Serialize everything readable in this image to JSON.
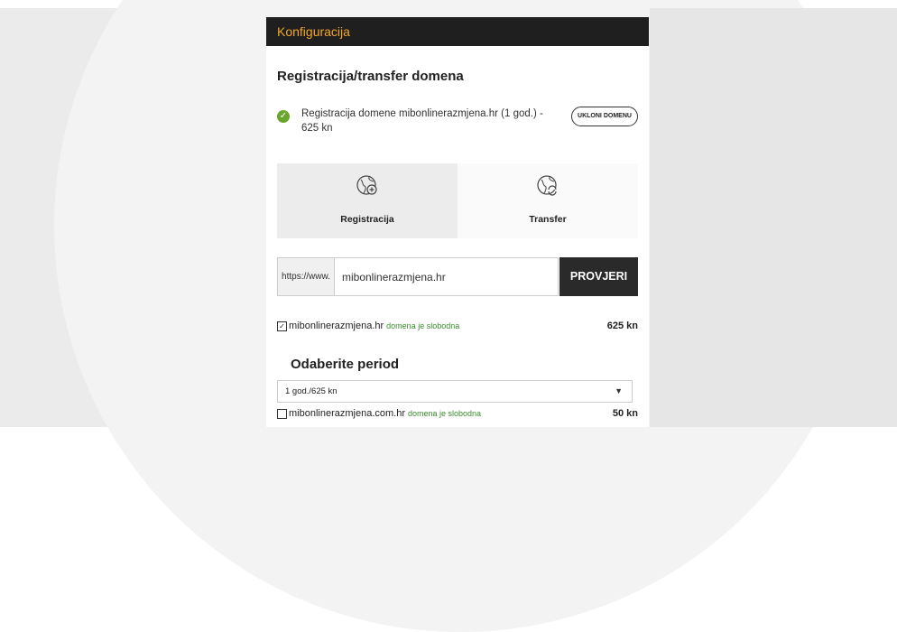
{
  "panel": {
    "header": "Konfiguracija",
    "section_title": "Registracija/transfer domena"
  },
  "registration": {
    "text": "Registracija domene mibonlinerazmjena.hr (1 god.) - 625 kn",
    "remove_button": "UKLONI DOMENU"
  },
  "tabs": [
    {
      "label": "Registracija",
      "icon": "globe-plus-icon",
      "active": true
    },
    {
      "label": "Transfer",
      "icon": "globe-arrows-icon",
      "active": false
    }
  ],
  "search": {
    "prefix": "https://www.",
    "value": "mibonlinerazmjena.hr",
    "button": "PROVJERI"
  },
  "results": [
    {
      "domain": "mibonlinerazmjena.hr",
      "status": "domena je slobodna",
      "price": "625 kn",
      "checked": true
    },
    {
      "domain": "mibonlinerazmjena.com.hr",
      "status": "domena je slobodna",
      "price": "50 kn",
      "checked": false
    }
  ],
  "period": {
    "title": "Odaberite period",
    "selected": "1 god./625 kn"
  },
  "colors": {
    "header_bg": "#1f1f1f",
    "header_text": "#f5a623",
    "success": "#6aa62e",
    "status_green": "#3a8b2f"
  }
}
